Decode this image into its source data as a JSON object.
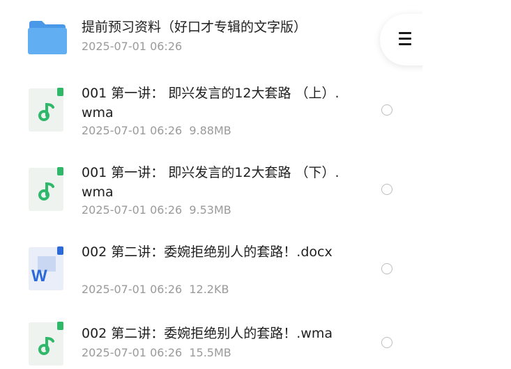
{
  "files": [
    {
      "title": "提前预习资料（好口才专辑的文字版）",
      "date": "2025-07-01 06:26",
      "size": "",
      "icon": "folder-icon"
    },
    {
      "title": "001 第一讲： 即兴发言的12大套路 （上）.wma",
      "date": "2025-07-01 06:26",
      "size": "9.88MB",
      "icon": "audio-file-icon"
    },
    {
      "title": "001 第一讲： 即兴发言的12大套路 （下）.wma",
      "date": "2025-07-01 06:26",
      "size": "9.53MB",
      "icon": "audio-file-icon"
    },
    {
      "title": "002 第二讲：委婉拒绝别人的套路！.docx",
      "date": "2025-07-01 06:26",
      "size": "12.2KB",
      "icon": "word-file-icon"
    },
    {
      "title": "002 第二讲：委婉拒绝别人的套路！.wma",
      "date": "2025-07-01 06:26",
      "size": "15.5MB",
      "icon": "audio-file-icon"
    }
  ],
  "menu": {
    "icon": "menu-icon"
  },
  "colors": {
    "folder": "#5aa9f2",
    "audio_accent": "#2fb86a",
    "word_accent": "#2b6ad8",
    "meta_text": "#9a9a9a",
    "title_text": "#1f1f1f"
  }
}
